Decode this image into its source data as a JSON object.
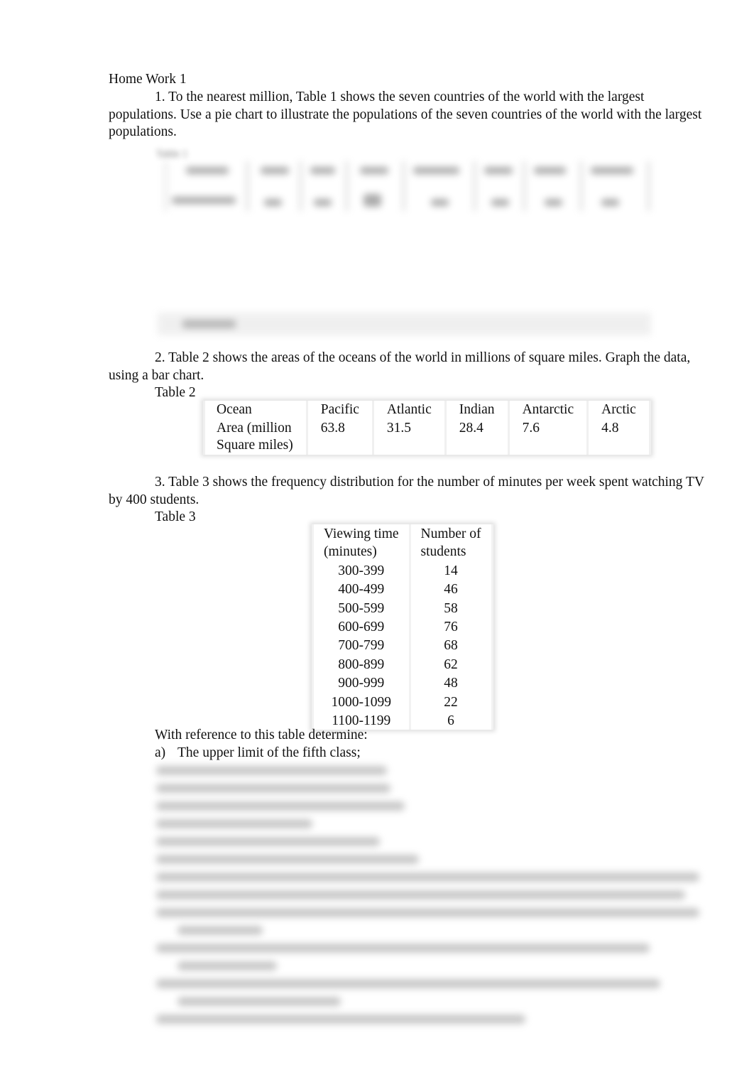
{
  "title": "Home Work 1",
  "q1": {
    "text": "1. To the nearest million,  Table 1  shows the seven countries of the world with the largest populations. Use a pie chart to illustrate the populations of the seven countries of the world with the largest populations.",
    "table_label": "Table 1",
    "table_obscured": true
  },
  "q2": {
    "text": "2. Table 2  shows the areas of the oceans of the world in millions of square miles. Graph the data, using a bar chart.",
    "table_label": "Table 2",
    "table": {
      "header": [
        "Ocean",
        "Pacific",
        "Atlantic",
        "Indian",
        "Antarctic",
        "Arctic"
      ],
      "row_label_line1": "Area (million",
      "row_label_line2": "Square miles)",
      "values": [
        "63.8",
        "31.5",
        "28.4",
        "7.6",
        "4.8"
      ]
    }
  },
  "q3": {
    "text": "3. Table 3  shows the frequency distribution for the number of minutes per week spent watching TV by 400 students.",
    "table_label": "Table 3",
    "table": {
      "header": [
        [
          "Viewing time",
          "(minutes)"
        ],
        [
          "Number of",
          "students"
        ]
      ],
      "rows": [
        [
          "300-399",
          "14"
        ],
        [
          "400-499",
          "46"
        ],
        [
          "500-599",
          "58"
        ],
        [
          "600-699",
          "76"
        ],
        [
          "700-799",
          "68"
        ],
        [
          "800-899",
          "62"
        ],
        [
          "900-999",
          "48"
        ],
        [
          "1000-1099",
          "22"
        ],
        [
          "1100-1199",
          "6"
        ]
      ]
    },
    "intro": "With reference to this table determine:",
    "items": [
      {
        "label": "a)",
        "text": "The upper limit of the fifth class;"
      }
    ],
    "remaining_items_obscured": true
  }
}
